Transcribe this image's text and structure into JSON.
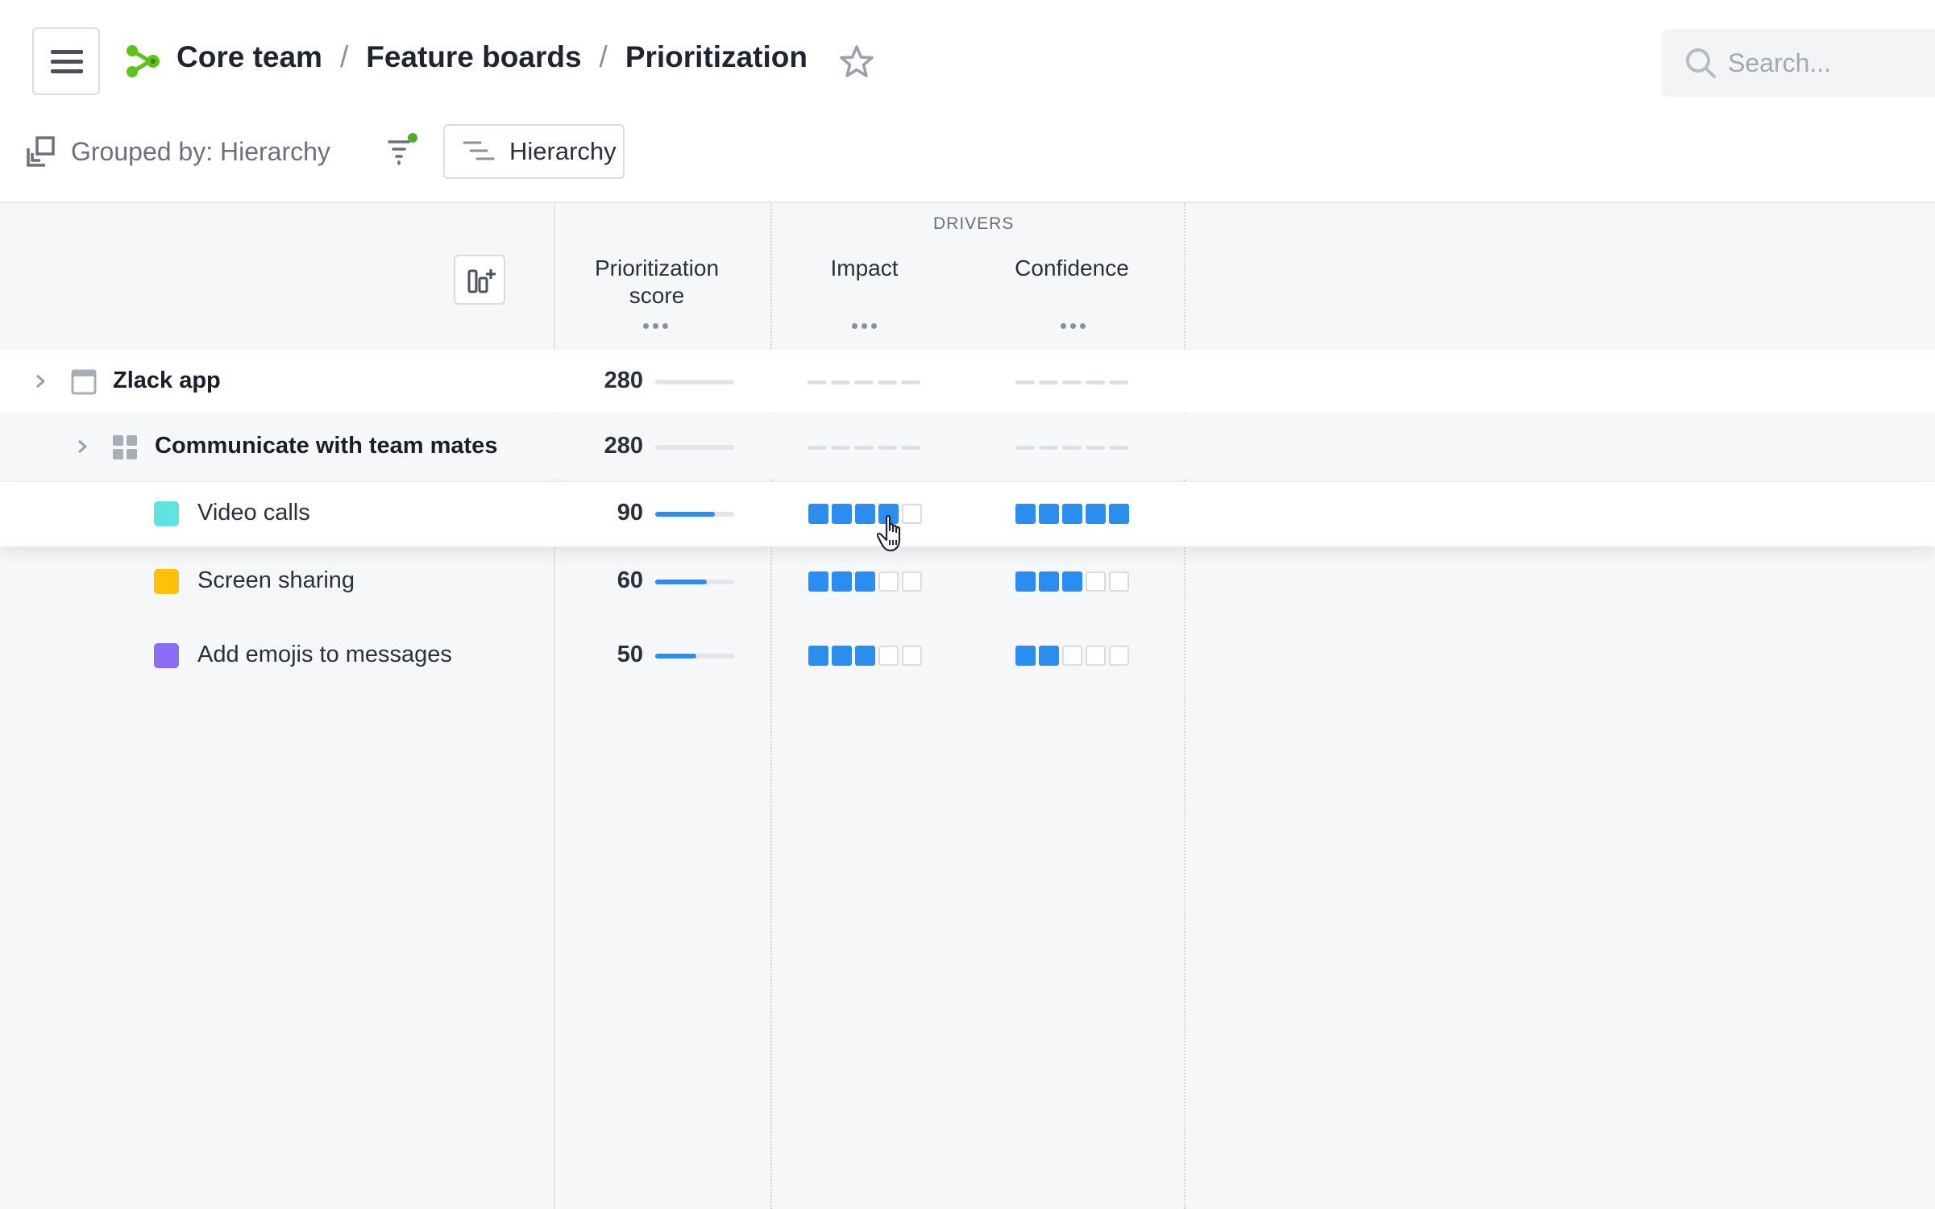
{
  "breadcrumb": {
    "workspace": "Core team",
    "section": "Feature boards",
    "page": "Prioritization",
    "separator": "/"
  },
  "search": {
    "placeholder": "Search..."
  },
  "toolbar": {
    "grouped_by": "Grouped by: Hierarchy",
    "hierarchy_button": "Hierarchy"
  },
  "columns": {
    "group_header": "DRIVERS",
    "score_line1": "Prioritization",
    "score_line2": "score",
    "impact": "Impact",
    "confidence": "Confidence"
  },
  "rows": [
    {
      "label": "Zlack app",
      "score": "280",
      "level": "product",
      "expandable": true
    },
    {
      "label": "Communicate with team mates",
      "score": "280",
      "level": "component",
      "expandable": true
    },
    {
      "label": "Video calls",
      "score": "90",
      "level": "feature",
      "color": "#5ee3e0",
      "impact": 4,
      "confidence": 5,
      "score_fraction": 0.75
    },
    {
      "label": "Screen sharing",
      "score": "60",
      "level": "feature",
      "color": "#ffc107",
      "impact": 3,
      "confidence": 3,
      "score_fraction": 0.65
    },
    {
      "label": "Add emojis to messages",
      "score": "50",
      "level": "feature",
      "color": "#8a6cf5",
      "impact": 3,
      "confidence": 2,
      "score_fraction": 0.52
    }
  ],
  "scale_max": 5,
  "colors": {
    "accent": "#2a8ef0",
    "logo": "#5cc31a",
    "filter_dot": "#4caf2a"
  }
}
